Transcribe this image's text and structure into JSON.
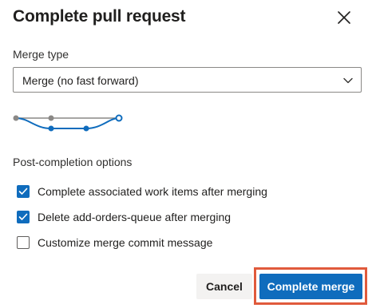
{
  "dialog": {
    "title": "Complete pull request",
    "close_icon": "close-icon"
  },
  "merge_type": {
    "label": "Merge type",
    "selected": "Merge (no fast forward)",
    "dropdown_icon": "chevron-down-icon"
  },
  "post_completion": {
    "label": "Post-completion options",
    "options": [
      {
        "label": "Complete associated work items after merging",
        "checked": true
      },
      {
        "label": "Delete add-orders-queue after merging",
        "checked": true
      },
      {
        "label": "Customize merge commit message",
        "checked": false
      }
    ]
  },
  "actions": {
    "cancel_label": "Cancel",
    "complete_label": "Complete merge"
  },
  "colors": {
    "accent": "#0f6cbd",
    "branch_gray": "#8a8886",
    "focus_highlight": "#e05a3c"
  }
}
